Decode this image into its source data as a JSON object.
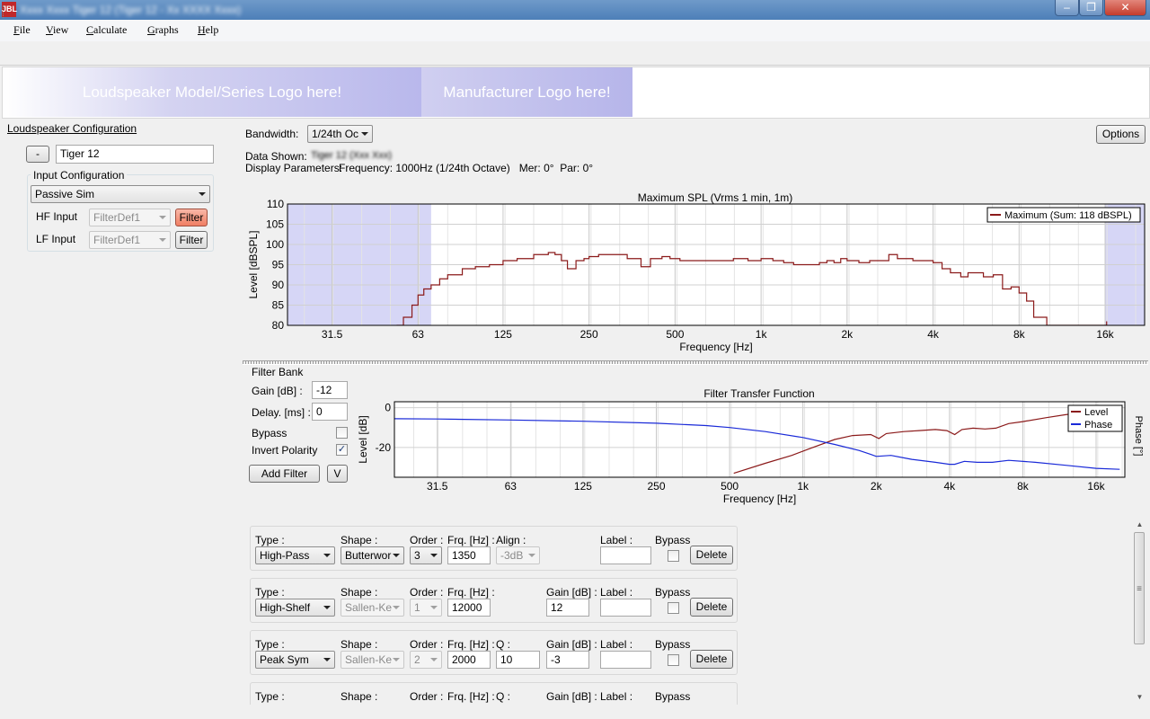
{
  "window": {
    "title": "Xxxx Xxxx Tiger 12 (Tiger 12 - Xx XXXX Xxxx)",
    "app_icon": "JBL",
    "minimize": "–",
    "maximize": "❐",
    "close": "✕"
  },
  "menu": [
    {
      "label": "File",
      "underline": "F",
      "rest": "ile"
    },
    {
      "label": "View",
      "underline": "V",
      "rest": "iew"
    },
    {
      "label": "Calculate",
      "underline": "C",
      "rest": "alculate"
    },
    {
      "label": "Graphs",
      "underline": "G",
      "rest": "raphs"
    },
    {
      "label": "Help",
      "underline": "H",
      "rest": "elp"
    }
  ],
  "logos": {
    "model": "Loudspeaker Model/Series Logo here!",
    "manufacturer": "Manufacturer Logo here!"
  },
  "config": {
    "title": "Loudspeaker Configuration",
    "minus_btn": "-",
    "name": "Tiger 12",
    "input_group": "Input Configuration",
    "input_mode": "Passive Sim",
    "hf_label": "HF Input",
    "hf_value": "FilterDef1",
    "hf_filter_btn": "Filter",
    "lf_label": "LF Input",
    "lf_value": "FilterDef1",
    "lf_filter_btn": "Filter"
  },
  "top": {
    "bandwidth_label": "Bandwidth:",
    "bandwidth_value": "1/24th Oc",
    "options_btn": "Options",
    "data_shown_label": "Data Shown:",
    "data_shown_value": "Tiger 12 (Xxx Xxx)",
    "display_label": "Display Parameters:",
    "display_value": "Frequency: 1000Hz (1/24th Octave)   Mer: 0°  Par: 0°"
  },
  "spl_chart": {
    "title": "Maximum SPL (Vrms 1 min, 1m)",
    "xlabel": "Frequency [Hz]",
    "ylabel": "Level [dBSPL]",
    "legend": "Maximum (Sum: 118 dBSPL)",
    "line_color": "#8b1a1a",
    "shade_color": "#d6d6f6"
  },
  "filter_bank": {
    "title": "Filter Bank",
    "gain_label": "Gain [dB] :",
    "gain_value": "-12",
    "delay_label": "Delay. [ms] :",
    "delay_value": "0",
    "bypass_label": "Bypass",
    "invert_label": "Invert Polarity",
    "invert_mark": "✓",
    "add_filter_btn": "Add Filter",
    "v_btn": "V"
  },
  "tf_chart": {
    "title": "Filter Transfer Function",
    "xlabel": "Frequency [Hz]",
    "ylabel": "Level [dB]",
    "ylabel_right": "Phase [°]",
    "legend_level": "Level",
    "legend_phase": "Phase",
    "level_color": "#8b1a1a",
    "phase_color": "#1a2ad8"
  },
  "chart_data": [
    {
      "type": "line",
      "title": "Maximum SPL (Vrms 1 min, 1m)",
      "xlabel": "Frequency [Hz]",
      "ylabel": "Level [dBSPL]",
      "xscale": "log2",
      "xlim": [
        20,
        22000
      ],
      "ylim": [
        80,
        110
      ],
      "xticks": [
        "31.5",
        "63",
        "125",
        "250",
        "500",
        "1k",
        "2k",
        "4k",
        "8k",
        "16k"
      ],
      "yticks": [
        "80",
        "85",
        "90",
        "95",
        "100",
        "105",
        "110"
      ],
      "grid": true,
      "legend_position": "top-right",
      "shaded_regions_hz": [
        [
          20,
          70
        ],
        [
          16000,
          22000
        ]
      ],
      "series": [
        {
          "name": "Maximum (Sum: 118 dBSPL)",
          "x": [
            53,
            56,
            60,
            63,
            66,
            70,
            75,
            80,
            90,
            100,
            112,
            125,
            140,
            160,
            180,
            190,
            200,
            210,
            225,
            240,
            250,
            270,
            300,
            340,
            380,
            410,
            450,
            480,
            520,
            560,
            620,
            700,
            800,
            900,
            1000,
            1100,
            1200,
            1300,
            1400,
            1500,
            1600,
            1700,
            1800,
            1900,
            2000,
            2200,
            2400,
            2600,
            2800,
            3000,
            3200,
            3400,
            3600,
            4000,
            4300,
            4600,
            5000,
            5300,
            5600,
            6000,
            6500,
            7000,
            7500,
            8000,
            8500,
            9000,
            10000,
            11000,
            12000,
            15800,
            16200
          ],
          "y": [
            80,
            82,
            85,
            87.5,
            89,
            90,
            91.5,
            92.5,
            94,
            94.5,
            95,
            96,
            96.5,
            97.5,
            98,
            97.5,
            96,
            94,
            96,
            96.5,
            97,
            97.5,
            97.5,
            96.5,
            94.5,
            96.5,
            97,
            96.5,
            96,
            96,
            96,
            96,
            96.5,
            96,
            96.5,
            96,
            95.5,
            95,
            95,
            95,
            95.5,
            96,
            95.5,
            96.5,
            96,
            95.5,
            96,
            96,
            97.5,
            96.5,
            96.5,
            96,
            96,
            95.5,
            94,
            93,
            92,
            93,
            93,
            92,
            92.5,
            89,
            89.5,
            88,
            86,
            82,
            80,
            80,
            80,
            80,
            81
          ]
        }
      ]
    },
    {
      "type": "line",
      "title": "Filter Transfer Function",
      "xlabel": "Frequency [Hz]",
      "ylabel": "Level [dB]",
      "ylabel_right": "Phase [°]",
      "xscale": "log2",
      "xlim": [
        20,
        22000
      ],
      "ylim": [
        -35,
        3
      ],
      "xticks": [
        "31.5",
        "63",
        "125",
        "250",
        "500",
        "1k",
        "2k",
        "4k",
        "8k",
        "16k"
      ],
      "yticks": [
        "0",
        "-20"
      ],
      "grid": true,
      "legend_position": "top-right",
      "series": [
        {
          "name": "Level",
          "x": [
            520,
            700,
            900,
            1100,
            1350,
            1600,
            1900,
            2050,
            2200,
            2600,
            3000,
            3500,
            3900,
            4200,
            4500,
            5000,
            5600,
            6200,
            7000,
            8000,
            10000,
            12000,
            14000,
            16000,
            18000,
            20000
          ],
          "y": [
            -33,
            -28,
            -24,
            -20,
            -16,
            -14,
            -13.5,
            -15.5,
            -13,
            -12,
            -11.5,
            -11,
            -11.5,
            -13.5,
            -11,
            -10.3,
            -10.7,
            -10.3,
            -8,
            -7,
            -5,
            -3.5,
            -2.5,
            -2,
            -2.5,
            -3
          ]
        },
        {
          "name": "Phase",
          "x": [
            20,
            31.5,
            63,
            125,
            250,
            400,
            500,
            700,
            1000,
            1350,
            1700,
            1900,
            2000,
            2300,
            2800,
            3500,
            4000,
            4200,
            4600,
            5200,
            6000,
            7000,
            9000,
            12000,
            16000,
            20000
          ],
          "y": [
            -5.5,
            -5.7,
            -6.2,
            -6.8,
            -7.8,
            -9,
            -10,
            -12,
            -15,
            -18.5,
            -21.5,
            -23.5,
            -24.5,
            -24,
            -26,
            -27.5,
            -28.5,
            -28.5,
            -27,
            -27.5,
            -27.5,
            -26.5,
            -27.5,
            -29,
            -30.5,
            -31
          ]
        }
      ]
    }
  ],
  "filters": [
    {
      "type_label": "Type :",
      "type": "High-Pass",
      "shape_label": "Shape :",
      "shape": "Butterwor",
      "shape_enabled": true,
      "order_label": "Order :",
      "order": "3",
      "order_enabled": true,
      "frq_label": "Frq. [Hz] :",
      "frq": "1350",
      "col5_label": "Align :",
      "col5_value": "-3dB",
      "col5_combo": true,
      "gain_label": "",
      "gain": "",
      "label_label": "Label :",
      "label": "",
      "bypass_label": "Bypass",
      "delete": "Delete"
    },
    {
      "type_label": "Type :",
      "type": "High-Shelf",
      "shape_label": "Shape :",
      "shape": "Sallen-Ke",
      "shape_enabled": false,
      "order_label": "Order :",
      "order": "1",
      "order_enabled": false,
      "frq_label": "Frq. [Hz] :",
      "frq": "12000",
      "col5_label": "",
      "col5_value": "",
      "col5_combo": false,
      "gain_label": "Gain [dB] :",
      "gain": "12",
      "label_label": "Label :",
      "label": "",
      "bypass_label": "Bypass",
      "delete": "Delete"
    },
    {
      "type_label": "Type :",
      "type": "Peak Sym",
      "shape_label": "Shape :",
      "shape": "Sallen-Ke",
      "shape_enabled": false,
      "order_label": "Order :",
      "order": "2",
      "order_enabled": false,
      "frq_label": "Frq. [Hz] :",
      "frq": "2000",
      "col5_label": "Q :",
      "col5_value": "10",
      "col5_combo": false,
      "gain_label": "Gain [dB] :",
      "gain": "-3",
      "label_label": "Label :",
      "label": "",
      "bypass_label": "Bypass",
      "delete": "Delete"
    },
    {
      "type_label": "Type :",
      "shape_label": "Shape :",
      "order_label": "Order :",
      "frq_label": "Frq. [Hz] :",
      "col5_label": "Q :",
      "gain_label": "Gain [dB] :",
      "label_label": "Label :",
      "bypass_label": "Bypass"
    }
  ],
  "scroll": {
    "up": "▲",
    "down": "▼",
    "grip": "≡"
  }
}
